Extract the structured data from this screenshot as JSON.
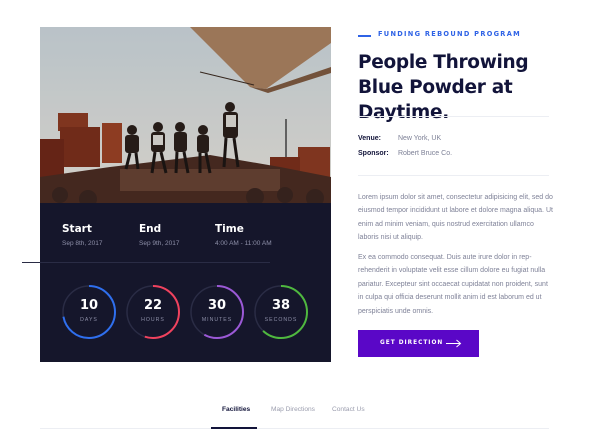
{
  "event": {
    "kicker": "FUNDING REBOUND PROGRAM",
    "title": "People Throwing Blue Powder at Daytime.",
    "venue_label": "Venue:",
    "venue_value": "New York, UK",
    "sponsor_label": "Sponsor:",
    "sponsor_value": "Robert Bruce Co.",
    "paragraphs": [
      "Lorem ipsum dolor sit amet, consectetur adipisicing elit, sed do eiusmod tempor incididunt ut labore et dolore magna aliqua. Ut enim ad minim veniam, quis nostrud exercitation ullamco laboris nisi ut aliquip.",
      "Ex ea commodo consequat. Duis aute irure dolor in rep-rehenderit in voluptate velit esse cillum dolore eu fugiat nulla pariatur. Excepteur sint occaecat cupidatat non proident, sunt in culpa qui officia deserunt mollit anim id est laborum ed ut perspiciatis unde omnis."
    ],
    "cta_label": "GET DIRECTION"
  },
  "schedule": {
    "start_label": "Start",
    "start_date": "Sep 8th, 2017",
    "end_label": "End",
    "end_date": "Sep 9th, 2017",
    "time_label": "Time",
    "time_value": "4:00 AM - 11:00 AM"
  },
  "countdown": [
    {
      "value": "10",
      "unit": "DAYS",
      "color": "#2f6fee",
      "progress": 0.72
    },
    {
      "value": "22",
      "unit": "HOURS",
      "color": "#f0425e",
      "progress": 0.55
    },
    {
      "value": "30",
      "unit": "MINUTES",
      "color": "#9b59d6",
      "progress": 0.58
    },
    {
      "value": "38",
      "unit": "SECONDS",
      "color": "#4fb83f",
      "progress": 0.62
    }
  ],
  "tabs": [
    {
      "label": "Facilities",
      "active": true
    },
    {
      "label": "Map Directions",
      "active": false
    },
    {
      "label": "Contact Us",
      "active": false
    }
  ],
  "colors": {
    "accent_blue": "#2f63e6",
    "cta_purple": "#5a07c7",
    "card_dark": "#15162b",
    "heading": "#12143a"
  },
  "icons": {
    "cta_icon": "arrow-right-icon"
  }
}
